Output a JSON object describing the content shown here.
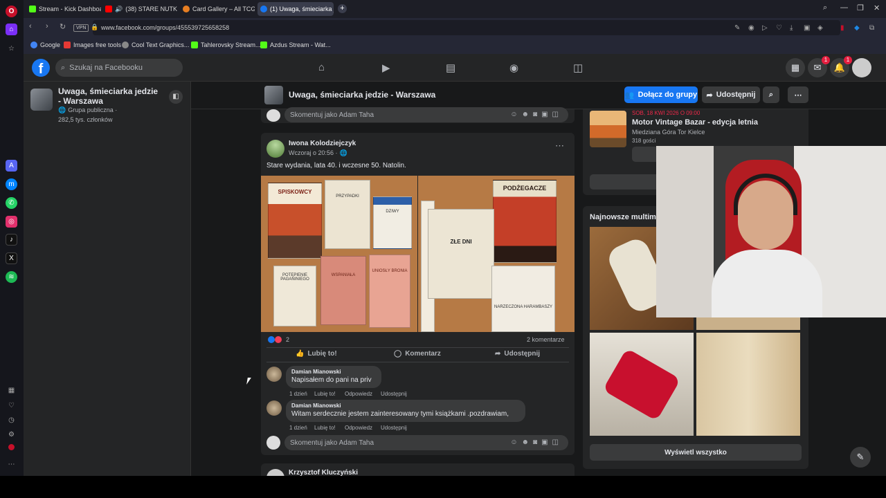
{
  "tabs": [
    {
      "label": "Stream - Kick Dashboard",
      "color": "#53fc18"
    },
    {
      "label": "(38) STARE NUTKI W ...",
      "color": "#ff0000"
    },
    {
      "label": "Card Gallery – All TCG Set...",
      "color": "#e67e22"
    },
    {
      "label": "(1) Uwaga, śmieciarka jedz...",
      "color": "#1877f2"
    }
  ],
  "address": {
    "vpn": "VPN",
    "url": "www.facebook.com/groups/455539725658258"
  },
  "bookmarks": [
    {
      "label": "Google",
      "color": "#4285f4"
    },
    {
      "label": "Images free tools",
      "color": "#e53935"
    },
    {
      "label": "Cool Text Graphics...",
      "color": "#888888"
    },
    {
      "label": "Tahlerovsky Stream...",
      "color": "#53fc18"
    },
    {
      "label": "Azdus Stream - Wat...",
      "color": "#53fc18"
    }
  ],
  "fb": {
    "logo": "f",
    "search_placeholder": "Szukaj na Facebooku",
    "messenger_badge": "1",
    "notif_badge": "1"
  },
  "group": {
    "name": "Uwaga, śmieciarka jedzie - Warszawa",
    "privacy": "Grupa publiczna ·",
    "members": "282,5 tys. członków",
    "join": "Dołącz do grupy",
    "share": "Udostępnij"
  },
  "composer": {
    "placeholder": "Skomentuj jako Adam Taha"
  },
  "post": {
    "author": "Iwona Kolodziejczyk",
    "time": "Wczoraj o 20:56 ·",
    "text": "Stare wydania, lata 40. i wczesne 50. Natolin.",
    "reactions": "2",
    "comments_count": "2 komentarze",
    "like": "Lubię to!",
    "comment": "Komentarz",
    "share": "Udostępnij",
    "books_left": [
      "SPISKOWCY",
      "PRZYPADKI",
      "DZIWY",
      "POTĘPIENIE PAGANINIEGO",
      "WSPANIAŁA",
      "UMIERAĆ",
      "UNIOSŁY BRONIA"
    ],
    "books_right": [
      "PODŻEGACZE",
      "ZŁE DNI",
      "NARZECZONA HARAMBASZY"
    ]
  },
  "comments": [
    {
      "author": "Damian Mianowski",
      "text": "Napisałem do pani na priv",
      "time": "1 dzień",
      "like": "Lubię to!",
      "reply": "Odpowiedz",
      "share": "Udostępnij"
    },
    {
      "author": "Damian Mianowski",
      "text": "Witam serdecznie jestem zainteresowany tymi książkami .pozdrawiam,",
      "time": "1 dzień",
      "like": "Lubię to!",
      "reply": "Odpowiedz",
      "share": "Udostępnij"
    }
  ],
  "next_post_author": "Krzysztof Kluczyński",
  "event": {
    "date": "SOB, 18 KWI 2026 O 09:00",
    "title": "Motor Vintage Bazar - edycja letnia",
    "place": "Miedziana Góra Tor Kielce",
    "guests": "318 gości"
  },
  "media": {
    "title": "Najnowsze multimedia",
    "show_all": "Wyświetl wszystko"
  },
  "colors": {
    "fb_blue": "#1877f2",
    "bg": "#18191a",
    "card": "#242526"
  }
}
